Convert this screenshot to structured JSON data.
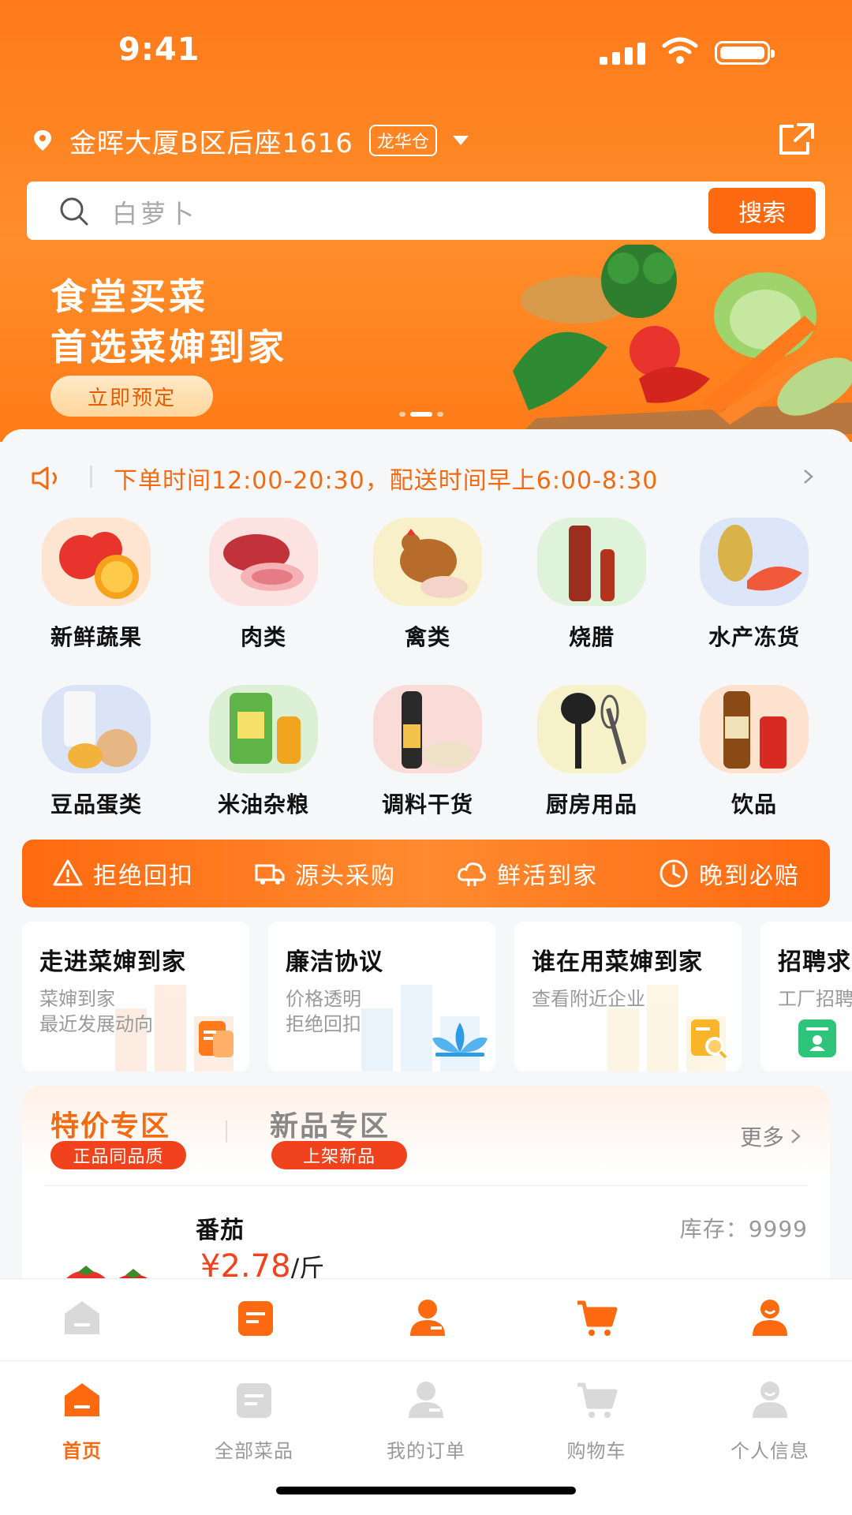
{
  "status_bar": {
    "time": "9:41"
  },
  "location": {
    "address": "金晖大厦B区后座1616",
    "warehouse_tag": "龙华仓"
  },
  "search": {
    "placeholder": "白萝卜",
    "button": "搜索"
  },
  "banner": {
    "line1": "食堂买菜",
    "line2": "首选菜婶到家",
    "cta": "立即预定"
  },
  "notice": {
    "text": "下单时间12:00-20:30，配送时间早上6:00-8:30"
  },
  "categories": [
    {
      "label": "新鲜蔬果",
      "icon": "fruit-veg-icon"
    },
    {
      "label": "肉类",
      "icon": "meat-icon"
    },
    {
      "label": "禽类",
      "icon": "poultry-icon"
    },
    {
      "label": "烧腊",
      "icon": "cured-meat-icon"
    },
    {
      "label": "水产冻货",
      "icon": "seafood-icon"
    },
    {
      "label": "豆品蛋类",
      "icon": "dairy-egg-icon"
    },
    {
      "label": "米油杂粮",
      "icon": "rice-oil-icon"
    },
    {
      "label": "调料干货",
      "icon": "seasoning-icon"
    },
    {
      "label": "厨房用品",
      "icon": "kitchen-icon"
    },
    {
      "label": "饮品",
      "icon": "drinks-icon"
    }
  ],
  "promises": [
    {
      "label": "拒绝回扣",
      "icon": "warning-icon"
    },
    {
      "label": "源头采购",
      "icon": "truck-icon"
    },
    {
      "label": "鲜活到家",
      "icon": "cloud-icon"
    },
    {
      "label": "晚到必赔",
      "icon": "clock-icon"
    }
  ],
  "info_cards": [
    {
      "title": "走进菜婶到家",
      "sub1": "菜婶到家",
      "sub2": "最近发展动向"
    },
    {
      "title": "廉洁协议",
      "sub1": "价格透明",
      "sub2": "拒绝回扣"
    },
    {
      "title": "谁在用菜婶到家",
      "sub1": "查看附近企业",
      "sub2": ""
    },
    {
      "title": "招聘求",
      "sub1": "工厂招聘",
      "sub2": ""
    }
  ],
  "special": {
    "tab1": "特价专区",
    "tab1_badge": "正品同品质",
    "tab2": "新品专区",
    "tab2_badge": "上架新品",
    "more": "更多",
    "product": {
      "name": "番茄",
      "stock": "库存：9999",
      "price": "¥2.78",
      "unit": "/斤"
    }
  },
  "tabs": [
    {
      "label": "首页",
      "active": true
    },
    {
      "label": "全部菜品",
      "active": false
    },
    {
      "label": "我的订单",
      "active": false
    },
    {
      "label": "购物车",
      "active": false
    },
    {
      "label": "个人信息",
      "active": false
    }
  ],
  "colors": {
    "brand": "#ff7a1a",
    "accent": "#f0421c",
    "text_orange": "#f26a12"
  }
}
